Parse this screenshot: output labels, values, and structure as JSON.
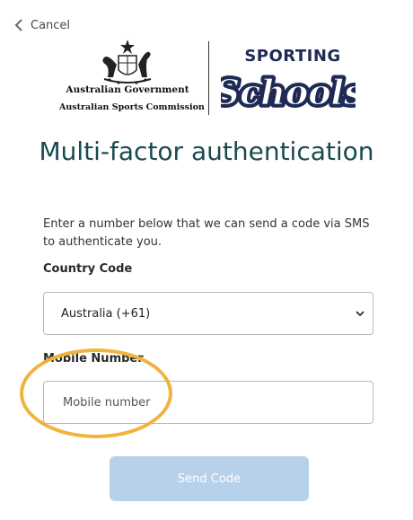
{
  "nav": {
    "cancel_label": "Cancel"
  },
  "logos": {
    "gov_line1": "Australian Government",
    "gov_line2": "Australian Sports Commission",
    "sporting_text": "SPORTING",
    "schools_text": "Schools"
  },
  "page": {
    "title": "Multi-factor authentication",
    "intro": "Enter a number below that we can send a code via SMS to authenticate you."
  },
  "form": {
    "country_label": "Country Code",
    "country_value": "Australia (+61)",
    "mobile_label": "Mobile Number",
    "mobile_placeholder": "Mobile number",
    "mobile_value": "",
    "send_label": "Send Code"
  },
  "colors": {
    "title": "#1a4a4f",
    "highlight": "#f0b43c",
    "send_button": "#b8d1ea"
  }
}
